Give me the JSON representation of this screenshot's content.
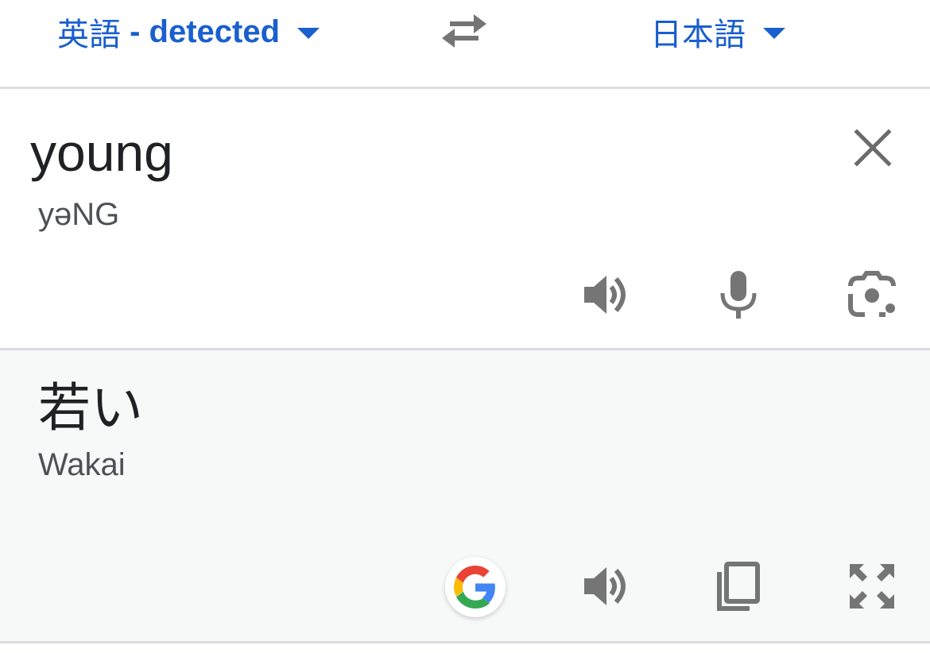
{
  "lang_bar": {
    "source_lang": "英語",
    "source_separator": " - ",
    "source_detected": "detected",
    "target_lang": "日本語"
  },
  "source": {
    "text": "young",
    "phonetic": "yəNG"
  },
  "target": {
    "text": "若い",
    "romanization": "Wakai"
  },
  "icons": {
    "swap": "swap-arrows-icon",
    "clear": "close-icon",
    "source_speaker": "speaker-icon",
    "mic": "mic-icon",
    "camera": "camera-icon",
    "google": "google-g-icon",
    "target_speaker": "speaker-icon",
    "copy": "copy-icon",
    "fullscreen": "fullscreen-icon"
  },
  "colors": {
    "accent": "#1a5fce",
    "icon": "#757575",
    "divider": "#dadce0"
  }
}
